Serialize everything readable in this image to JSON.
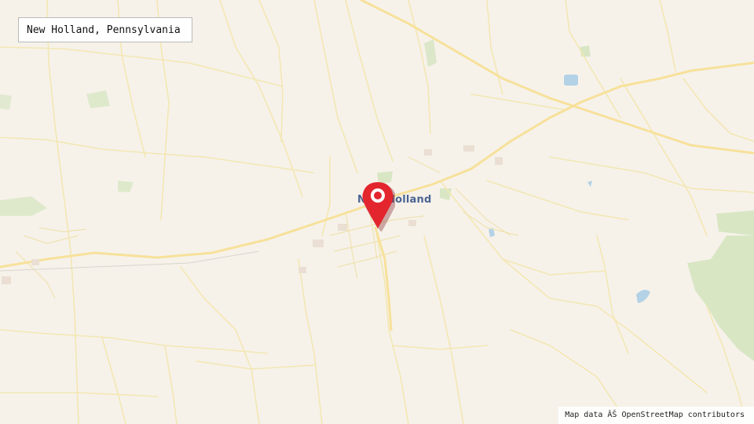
{
  "map": {
    "title": "New Holland, Pennsylvania",
    "place_label": "New Holland",
    "attribution": "Map data ÂŠ OpenStreetMap contributors",
    "marker_icon": "map-pin-icon",
    "colors": {
      "land": "#f6f2ea",
      "road": "#f7e6a6",
      "major_road": "#f4da85",
      "park": "#d8e6c4",
      "water": "#b3d2e6",
      "marker": "#e3262e",
      "label": "#4a6391"
    }
  }
}
